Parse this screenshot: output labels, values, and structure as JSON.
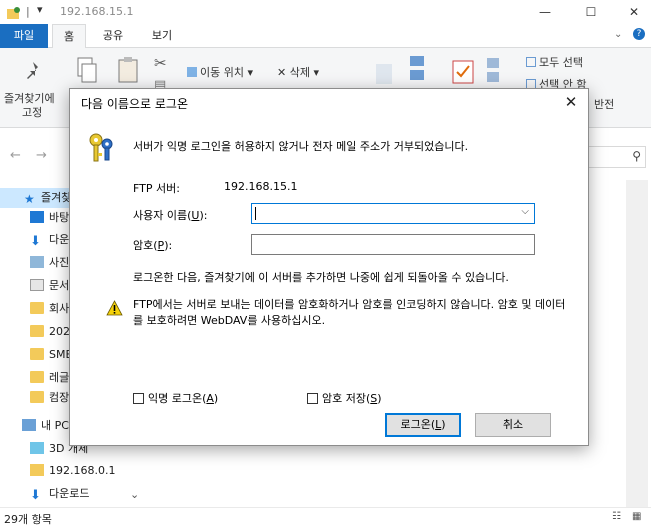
{
  "window": {
    "title": "192.168.15.1",
    "minimize": "—",
    "maximize": "☐",
    "close": "✕"
  },
  "ribbon": {
    "tabs": [
      "파일",
      "홈",
      "공유",
      "보기"
    ],
    "pin_line1": "즐겨찾기에",
    "pin_line2": "고정",
    "move_to": "이동 위치 ▾",
    "delete": "✕ 삭제 ▾",
    "select_all": "모두 선택",
    "select_none": "선택 안 함",
    "invert": "반전"
  },
  "sidebar": {
    "items": [
      {
        "label": "즐겨찾",
        "icon": "star-icon"
      },
      {
        "label": "바탕",
        "icon": "desktop-icon"
      },
      {
        "label": "다운",
        "icon": "download-icon"
      },
      {
        "label": "사진",
        "icon": "pictures-icon"
      },
      {
        "label": "문서",
        "icon": "documents-icon"
      },
      {
        "label": "회사",
        "icon": "folder-icon"
      },
      {
        "label": "2021",
        "icon": "folder-icon"
      },
      {
        "label": "SMB",
        "icon": "folder-icon"
      },
      {
        "label": "레글",
        "icon": "folder-icon"
      },
      {
        "label": "컴장",
        "icon": "folder-icon"
      },
      {
        "label": "내 PC",
        "icon": "pc-icon"
      },
      {
        "label": "3D 개체",
        "icon": "3d-objects-icon"
      },
      {
        "label": "192.168.0.1",
        "icon": "ftp-location-icon"
      },
      {
        "label": "다운로드",
        "icon": "download-icon"
      }
    ]
  },
  "status": {
    "item_count": "29개 항목"
  },
  "dialog": {
    "title": "다음 이름으로 로그온",
    "message": "서버가 익명 로그인을 허용하지 않거나 전자 메일 주소가 거부되었습니다.",
    "server_label": "FTP 서버:",
    "server_value": "192.168.15.1",
    "username_label_pre": "사용자 이름(",
    "username_label_key": "U",
    "username_label_post": "):",
    "username_value": "",
    "password_label_pre": "암호(",
    "password_label_key": "P",
    "password_label_post": "):",
    "password_value": "",
    "info": "로그온한 다음, 즐겨찾기에 이 서버를 추가하면 나중에 쉽게 되돌아올 수 있습니다.",
    "warning": "FTP에서는 서버로 보내는 데이터를 암호화하거나 암호를 인코딩하지 않습니다. 암호 및 데이터를 보호하려면 WebDAV를 사용하십시오.",
    "anon_pre": "익명 로그온(",
    "anon_key": "A",
    "anon_post": ")",
    "anon_checked": false,
    "save_pre": "암호 저장(",
    "save_key": "S",
    "save_post": ")",
    "save_checked": false,
    "logon_pre": "로그온(",
    "logon_key": "L",
    "logon_post": ")",
    "cancel": "취소",
    "close": "✕"
  }
}
